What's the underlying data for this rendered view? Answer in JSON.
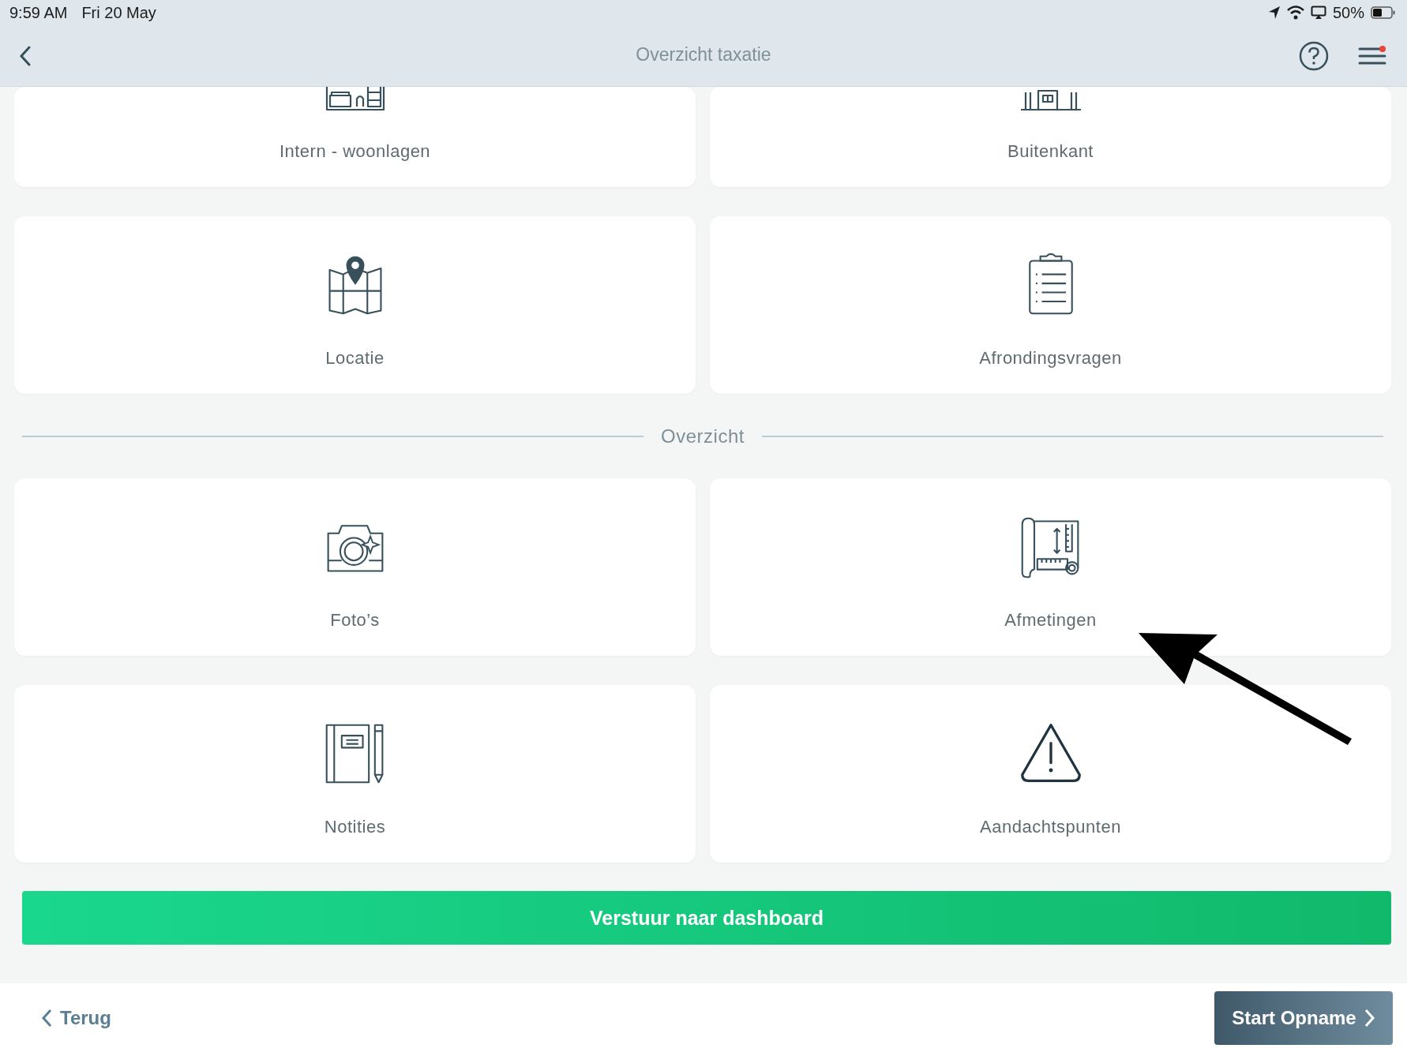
{
  "status_bar": {
    "time": "9:59 AM",
    "date": "Fri 20 May",
    "battery": "50%"
  },
  "nav": {
    "title": "Overzicht taxatie",
    "has_notification": true
  },
  "sections": [
    {
      "tiles": [
        {
          "label": "Intern - woonlagen"
        },
        {
          "label": "Buitenkant"
        },
        {
          "label": "Locatie"
        },
        {
          "label": "Afrondingsvragen"
        }
      ]
    },
    {
      "heading": "Overzicht",
      "tiles": [
        {
          "label": "Foto’s"
        },
        {
          "label": "Afmetingen"
        },
        {
          "label": "Notities"
        },
        {
          "label": "Aandachtspunten"
        }
      ]
    }
  ],
  "primary_button": "Verstuur naar dashboard",
  "footer": {
    "back": "Terug",
    "next": "Start Opname"
  }
}
